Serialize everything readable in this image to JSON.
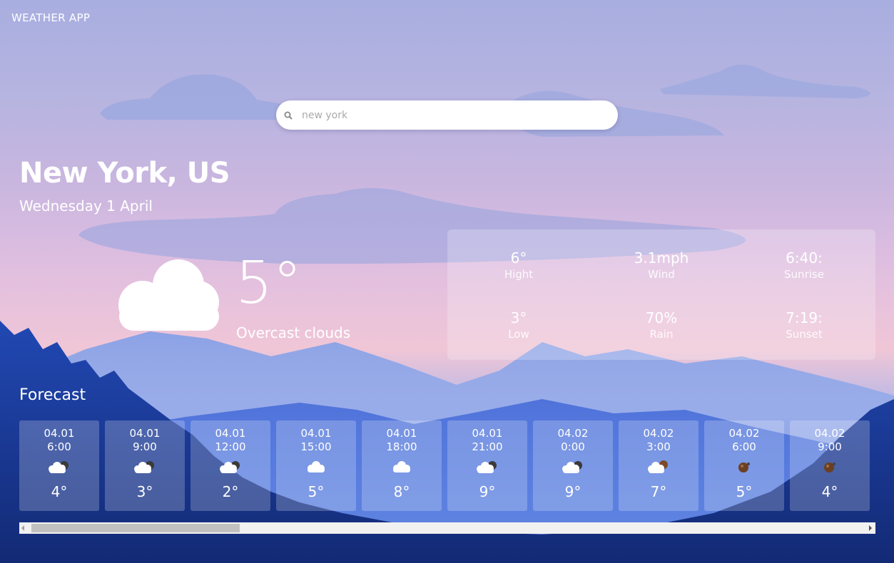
{
  "app": {
    "title": "WEATHER APP"
  },
  "search": {
    "placeholder": "new york"
  },
  "location": {
    "city": "New York, US",
    "date": "Wednesday 1 April"
  },
  "current": {
    "temp": "5°",
    "description": "Overcast clouds",
    "icon": "cloud-icon"
  },
  "details": [
    {
      "value": "6°",
      "label": "Hight"
    },
    {
      "value": "3.1mph",
      "label": "Wind"
    },
    {
      "value": "6:40:",
      "label": "Sunrise"
    },
    {
      "value": "3°",
      "label": "Low"
    },
    {
      "value": "70%",
      "label": "Rain"
    },
    {
      "value": "7:19:",
      "label": "Sunset"
    }
  ],
  "forecast": {
    "title": "Forecast",
    "items": [
      {
        "date": "04.01",
        "time": "6:00",
        "temp": "4°",
        "icon": "cloud-sun-icon"
      },
      {
        "date": "04.01",
        "time": "9:00",
        "temp": "3°",
        "icon": "cloud-sun-icon"
      },
      {
        "date": "04.01",
        "time": "12:00",
        "temp": "2°",
        "icon": "cloud-sun-icon"
      },
      {
        "date": "04.01",
        "time": "15:00",
        "temp": "5°",
        "icon": "cloud-icon"
      },
      {
        "date": "04.01",
        "time": "18:00",
        "temp": "8°",
        "icon": "cloud-icon"
      },
      {
        "date": "04.01",
        "time": "21:00",
        "temp": "9°",
        "icon": "cloud-sun-icon"
      },
      {
        "date": "04.02",
        "time": "0:00",
        "temp": "9°",
        "icon": "cloud-sun-icon"
      },
      {
        "date": "04.02",
        "time": "3:00",
        "temp": "7°",
        "icon": "cloud-rain-icon"
      },
      {
        "date": "04.02",
        "time": "6:00",
        "temp": "5°",
        "icon": "rain-drop-icon"
      },
      {
        "date": "04.02",
        "time": "9:00",
        "temp": "4°",
        "icon": "rain-drop-icon"
      }
    ]
  },
  "colors": {
    "accent": "#ffffff",
    "panel": "rgba(255,255,255,0.22)",
    "sky_top": "#a8aee0",
    "forest": "#1a2f7a"
  }
}
